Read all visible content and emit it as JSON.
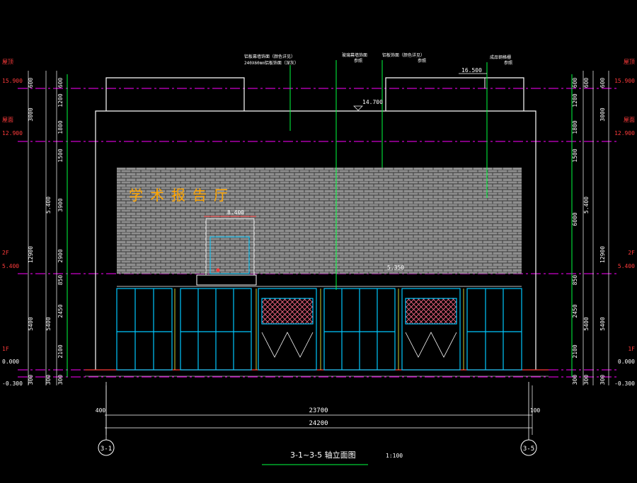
{
  "levels": {
    "roof": {
      "name": "屋顶",
      "elev": "15.900"
    },
    "upper_roof": {
      "name": "屋面",
      "elev": "12.900"
    },
    "f2": {
      "name": "2F",
      "elev": "5.400"
    },
    "f1": {
      "name": "1F",
      "elev": "0.000"
    },
    "ground": {
      "elev": "-0.300"
    }
  },
  "elevation_marks": {
    "parapet": "16.500",
    "roof": "14.700",
    "canopy": "8.400",
    "mid": "5.350"
  },
  "facade_sign": "学术报告厅",
  "left_dims": {
    "outer": [
      "300",
      "5400",
      "12900",
      "3000",
      "600"
    ],
    "middle": [
      "300",
      "2100",
      "2450",
      "1800",
      "2900",
      "3900",
      "1500",
      "1800",
      "1200",
      "600"
    ],
    "small": [
      "850"
    ]
  },
  "right_dims": {
    "outer": [
      "300",
      "5400",
      "12900",
      "3000",
      "600"
    ],
    "middle": [
      "300",
      "2100",
      "2450",
      "1800",
      "6000",
      "1500",
      "1800",
      "1200",
      "600"
    ],
    "small": [
      "850"
    ]
  },
  "overall_dims": {
    "left_offset": "400",
    "inner": "23700",
    "right_offset": "100",
    "total": "24200"
  },
  "axes": {
    "left": "3-1",
    "right": "3-5"
  },
  "annotations": [
    {
      "line1": "铝板幕墙饰面（颜色详见）",
      "line2": "240X60mm铝板饰面（深灰）"
    },
    {
      "line1": "玻璃幕墙饰面",
      "line2": "参照"
    },
    {
      "line1": "铝板饰面（颜色详见）",
      "line2": "参照"
    },
    {
      "line1": "成品钢格栅",
      "line2": "参照"
    }
  ],
  "title": "3-1~3-5 轴立面图",
  "scale": "1:100",
  "colors": {
    "red": "#ff3b3b",
    "magenta": "#ff00ff",
    "cyan": "#00c8ff",
    "green": "#00ff40",
    "yellow": "#ffff40",
    "white": "#ffffff",
    "orange": "#ffa500",
    "gray": "#8c8c8c"
  }
}
